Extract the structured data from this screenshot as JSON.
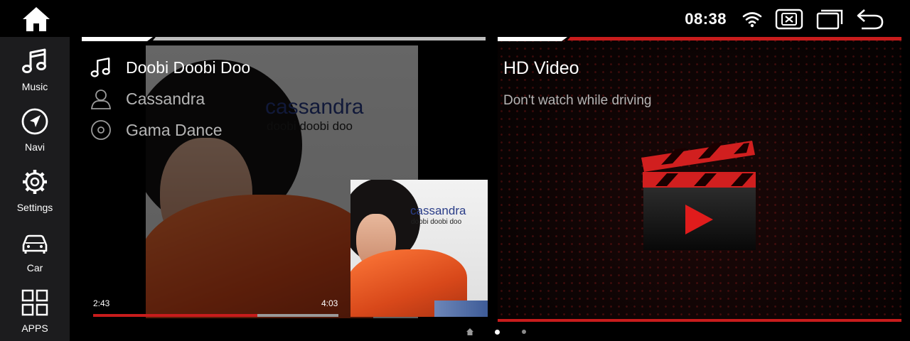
{
  "status_bar": {
    "time": "08:38",
    "icons": [
      "wifi-icon",
      "close-window-icon",
      "recent-apps-icon",
      "back-icon"
    ]
  },
  "home_icon": "home-icon",
  "sidebar": {
    "items": [
      {
        "label": "Music",
        "icon": "music-note-icon"
      },
      {
        "label": "Navi",
        "icon": "navigation-icon"
      },
      {
        "label": "Settings",
        "icon": "gear-icon"
      },
      {
        "label": "Car",
        "icon": "car-icon"
      },
      {
        "label": "APPS",
        "icon": "apps-grid-icon"
      }
    ]
  },
  "music": {
    "title": "Doobi Doobi Doo",
    "artist": "Cassandra",
    "album": "Gama Dance",
    "elapsed": "2:43",
    "duration": "4:03",
    "progress": 0.67,
    "album_art": {
      "title": "cassandra",
      "subtitle": "doobi doobi doo"
    }
  },
  "video": {
    "title": "HD Video",
    "subtitle": "Don't watch while driving"
  },
  "pager": {
    "pages": 3,
    "active": 1
  },
  "colors": {
    "accent": "#c81c1c",
    "sidebar_bg": "#1c1c1e",
    "text_dim": "#b5b5b5",
    "progress_track": "#9a9a9a"
  }
}
